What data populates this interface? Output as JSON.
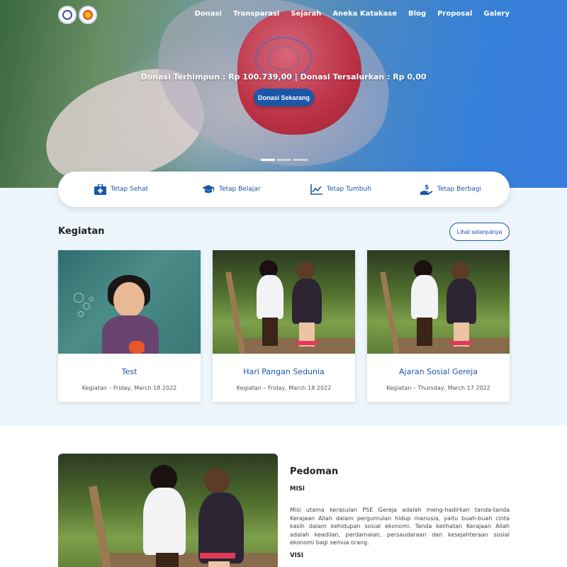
{
  "nav": {
    "items": [
      "Donasi",
      "Transparasi",
      "Sejarah",
      "Aneka Katakase",
      "Blog",
      "Proposal",
      "Galery"
    ]
  },
  "hero": {
    "donation_text": "Donasi Terhimpun : Rp 100.739,00 | Donasi Tersalurkan : Rp 0,00",
    "cta_label": "Donasi Sekarang",
    "slides": 3,
    "active_slide": 1
  },
  "pillars": [
    {
      "label": "Tetap Sehat",
      "icon": "first-aid-kit-icon"
    },
    {
      "label": "Tetap Belajar",
      "icon": "graduation-cap-icon"
    },
    {
      "label": "Tetap Tumbuh",
      "icon": "chart-line-icon"
    },
    {
      "label": "Tetap Berbagi",
      "icon": "hand-holding-dollar-icon"
    }
  ],
  "kegiatan": {
    "title": "Kegiatan",
    "more_label": "Lihat selanjutnya",
    "cards": [
      {
        "title": "Test",
        "meta": "Kegiatan – Friday, March 18 2022"
      },
      {
        "title": "Hari Pangan Sedunia",
        "meta": "Kegiatan – Friday, March 18 2022"
      },
      {
        "title": "Ajaran Sosial Gereja",
        "meta": "Kegiatan – Thursday, March 17 2022"
      }
    ]
  },
  "pedoman": {
    "title": "Pedoman",
    "misi_heading": "MISI",
    "misi_text": "Misi utama kerasulan PSE Gereja adalah meng-hadirkan tanda-tanda Kerajaan Allah dalam pergumulan hidup manusia, yaitu buah-buah cinta kasih dalam kehidupan sosial ekonomi. Tanda kelihatan Kerajaan Allah adalah keadilan, perdamaian, persaudaraan dan kesejahteraan sosial ekonomi bagi semua orang.",
    "visi_heading": "VISI"
  },
  "colors": {
    "primary": "#1b57a8",
    "section_bg": "#eef6fd"
  }
}
